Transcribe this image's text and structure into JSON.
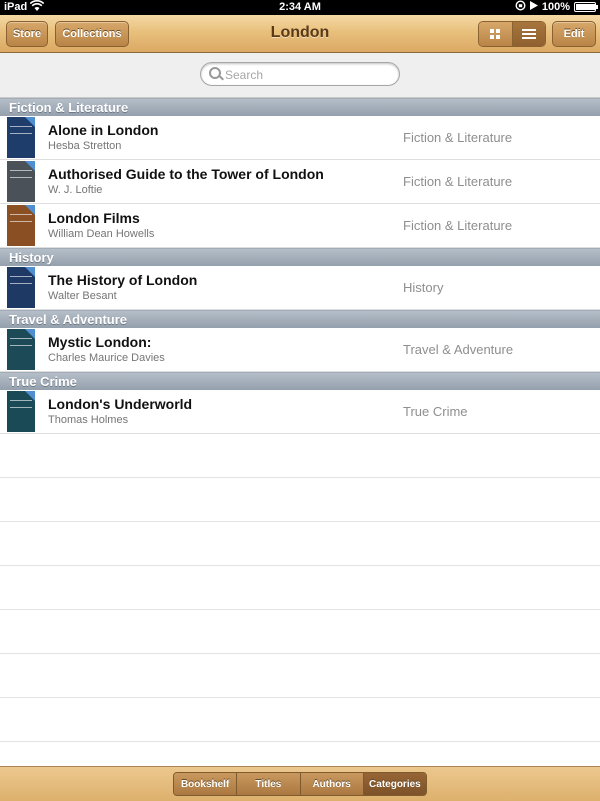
{
  "status": {
    "device": "iPad",
    "time": "2:34 AM",
    "battery": "100%"
  },
  "toolbar": {
    "store": "Store",
    "collections": "Collections",
    "title": "London",
    "edit": "Edit"
  },
  "search": {
    "placeholder": "Search"
  },
  "colors": {
    "toolbar_wood": "#e8c07c",
    "section_header": "#a2adba",
    "text_primary": "#111111",
    "text_secondary": "#757575"
  },
  "sections": [
    {
      "header": "Fiction & Literature",
      "rows": [
        {
          "title": "Alone in London",
          "author": "Hesba Stretton",
          "category": "Fiction & Literature",
          "cover_color": "#1f3d6a"
        },
        {
          "title": "Authorised Guide to the Tower of London",
          "author": "W. J. Loftie",
          "category": "Fiction & Literature",
          "cover_color": "#4a5158"
        },
        {
          "title": "London Films",
          "author": "William Dean Howells",
          "category": "Fiction & Literature",
          "cover_color": "#8a4f23"
        }
      ]
    },
    {
      "header": "History",
      "rows": [
        {
          "title": "The History of London",
          "author": "Walter Besant",
          "category": "History",
          "cover_color": "#1d3964"
        }
      ]
    },
    {
      "header": "Travel & Adventure",
      "rows": [
        {
          "title": "Mystic London:",
          "author": "Charles Maurice Davies",
          "category": "Travel & Adventure",
          "cover_color": "#1d4a57"
        }
      ]
    },
    {
      "header": "True Crime",
      "rows": [
        {
          "title": "London's Underworld",
          "author": "Thomas Holmes",
          "category": "True Crime",
          "cover_color": "#1a4a56"
        }
      ]
    }
  ],
  "tabs": [
    "Bookshelf",
    "Titles",
    "Authors",
    "Categories"
  ],
  "selected_tab": "Categories"
}
